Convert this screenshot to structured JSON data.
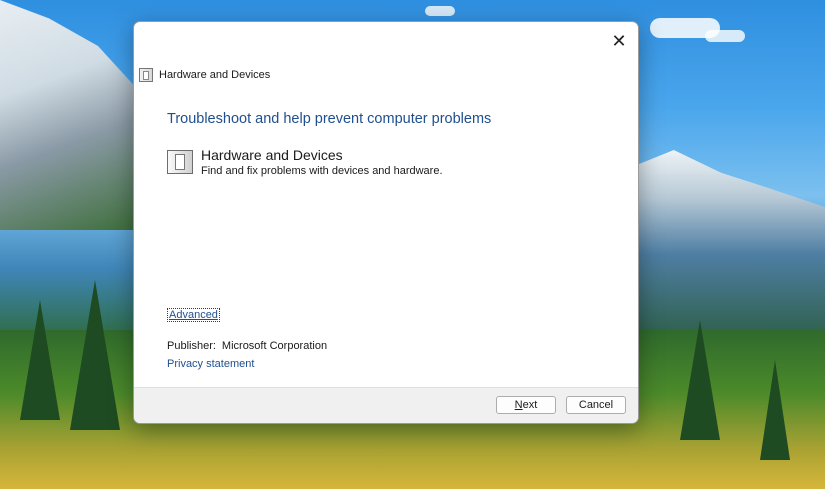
{
  "window": {
    "title": "Hardware and Devices",
    "close_label": "✕"
  },
  "content": {
    "heading": "Troubleshoot and help prevent computer problems",
    "task_title": "Hardware and Devices",
    "task_description": "Find and fix problems with devices and hardware.",
    "advanced_link": "Advanced",
    "publisher_label": "Publisher:",
    "publisher_value": "Microsoft Corporation",
    "privacy_link": "Privacy statement"
  },
  "footer": {
    "next_mnemonic": "N",
    "next_rest": "ext",
    "cancel_label": "Cancel"
  },
  "icons": {
    "window_icon": "device-icon",
    "task_icon": "device-icon",
    "close_icon": "close-icon"
  }
}
